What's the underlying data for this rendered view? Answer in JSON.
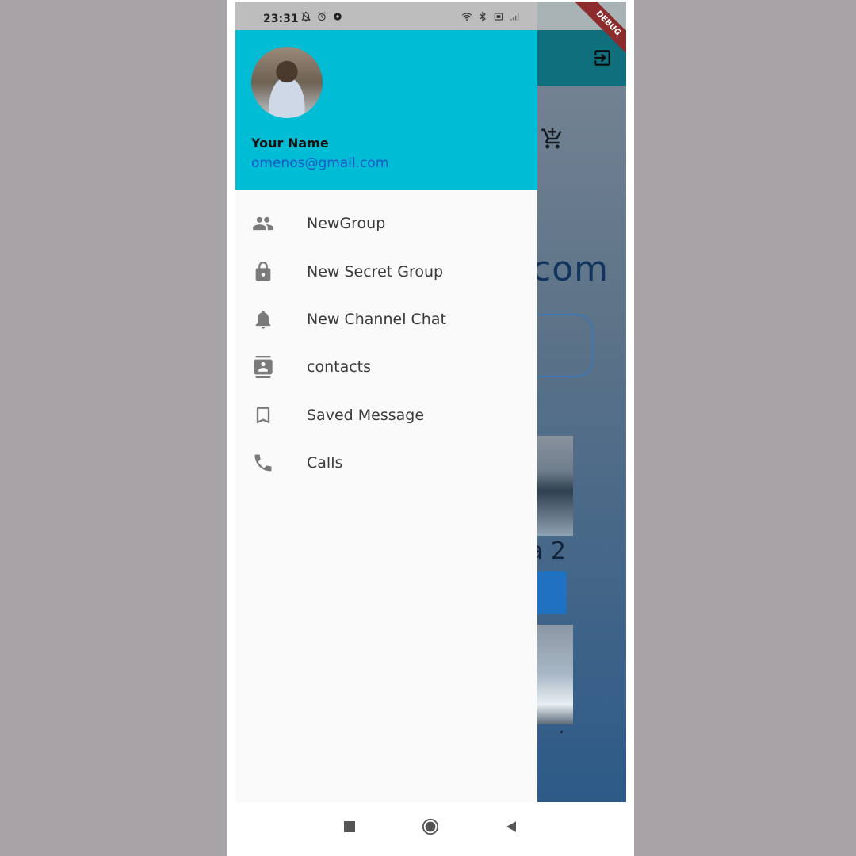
{
  "status_bar": {
    "time": "23:31",
    "icons": [
      "bell-off-icon",
      "alarm-icon",
      "settings-icon",
      "wifi-icon",
      "bluetooth-icon",
      "sim-icon",
      "signal-icon",
      "battery-icon"
    ]
  },
  "drawer": {
    "header": {
      "name": "Your Name",
      "email": "omenos@gmail.com",
      "background": "#00bcd4"
    },
    "items": [
      {
        "label": "NewGroup",
        "icon": "group-icon"
      },
      {
        "label": "New Secret Group",
        "icon": "lock-icon"
      },
      {
        "label": "New Channel Chat",
        "icon": "bell-icon"
      },
      {
        "label": "contacts",
        "icon": "contacts-icon"
      },
      {
        "label": "Saved Message",
        "icon": "bookmark-icon"
      },
      {
        "label": "Calls",
        "icon": "phone-icon"
      }
    ]
  },
  "background_app": {
    "partial_text_1": "com",
    "partial_text_2": "a 2",
    "debug_banner": "DEBUG",
    "app_bar_color": "#0f6f7c"
  },
  "navigation_bar": {
    "buttons": [
      "recent-apps-button",
      "home-button",
      "back-button"
    ]
  }
}
